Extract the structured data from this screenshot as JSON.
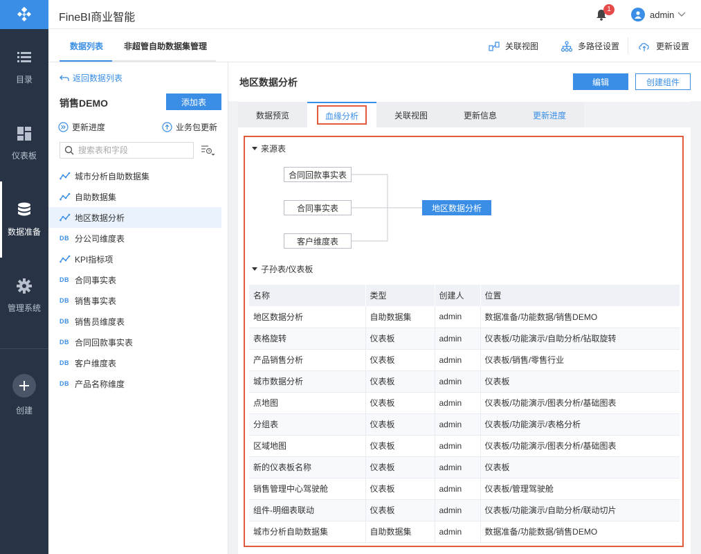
{
  "app": {
    "title": "FineBI商业智能"
  },
  "colors": {
    "accent": "#3a8ee6",
    "nav_bg": "#283445",
    "highlight": "#e05a3c"
  },
  "header": {
    "notification_count": "1",
    "username": "admin"
  },
  "leftnav": {
    "items": [
      {
        "label": "目录",
        "icon": "list-icon"
      },
      {
        "label": "仪表板",
        "icon": "dashboard-icon"
      },
      {
        "label": "数据准备",
        "icon": "database-icon"
      },
      {
        "label": "管理系统",
        "icon": "gear-icon"
      },
      {
        "label": "创建",
        "icon": "plus-icon"
      }
    ]
  },
  "subheader": {
    "tabs": [
      "数据列表",
      "非超管自助数据集管理"
    ],
    "tools": [
      "关联视图",
      "多路径设置",
      "更新设置"
    ]
  },
  "leftpanel": {
    "back": "返回数据列表",
    "package_title": "销售DEMO",
    "add_table": "添加表",
    "update_progress": "更新进度",
    "package_update": "业务包更新",
    "search_placeholder": "搜索表和字段",
    "tables": [
      {
        "name": "城市分析自助数据集",
        "type": "self"
      },
      {
        "name": "自助数据集",
        "type": "self"
      },
      {
        "name": "地区数据分析",
        "type": "self"
      },
      {
        "name": "分公司维度表",
        "type": "db"
      },
      {
        "name": "KPI指标项",
        "type": "self"
      },
      {
        "name": "合同事实表",
        "type": "db"
      },
      {
        "name": "销售事实表",
        "type": "db"
      },
      {
        "name": "销售员维度表",
        "type": "db"
      },
      {
        "name": "合同回款事实表",
        "type": "db"
      },
      {
        "name": "客户维度表",
        "type": "db"
      },
      {
        "name": "产品名称维度",
        "type": "db"
      }
    ],
    "db_tag": "DB"
  },
  "main": {
    "title": "地区数据分析",
    "edit": "编辑",
    "create_component": "创建组件",
    "tabs": [
      "数据预览",
      "血缘分析",
      "关联视图",
      "更新信息",
      "更新进度"
    ],
    "source_section": "来源表",
    "sources": [
      "合同回款事实表",
      "合同事实表",
      "客户维度表"
    ],
    "target": "地区数据分析",
    "children_section": "子孙表/仪表板",
    "table": {
      "headers": [
        "名称",
        "类型",
        "创建人",
        "位置"
      ],
      "rows": [
        [
          "地区数据分析",
          "自助数据集",
          "admin",
          "数据准备/功能数据/销售DEMO"
        ],
        [
          "表格旋转",
          "仪表板",
          "admin",
          "仪表板/功能演示/自助分析/钻取旋转"
        ],
        [
          "产品销售分析",
          "仪表板",
          "admin",
          "仪表板/销售/零售行业"
        ],
        [
          "城市数据分析",
          "仪表板",
          "admin",
          "仪表板"
        ],
        [
          "点地图",
          "仪表板",
          "admin",
          "仪表板/功能演示/图表分析/基础图表"
        ],
        [
          "分组表",
          "仪表板",
          "admin",
          "仪表板/功能演示/表格分析"
        ],
        [
          "区域地图",
          "仪表板",
          "admin",
          "仪表板/功能演示/图表分析/基础图表"
        ],
        [
          "新的仪表板名称",
          "仪表板",
          "admin",
          "仪表板"
        ],
        [
          "销售管理中心驾驶舱",
          "仪表板",
          "admin",
          "仪表板/管理驾驶舱"
        ],
        [
          "组件-明细表联动",
          "仪表板",
          "admin",
          "仪表板/功能演示/自助分析/联动切片"
        ],
        [
          "城市分析自助数据集",
          "自助数据集",
          "admin",
          "数据准备/功能数据/销售DEMO"
        ]
      ]
    }
  }
}
